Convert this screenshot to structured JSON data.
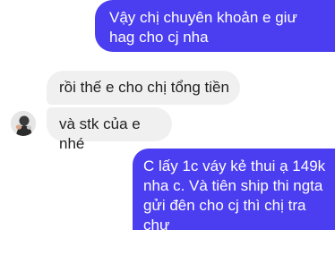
{
  "conversation": {
    "messages": [
      {
        "direction": "sent",
        "text": "Vậy chị chuyên khoản e giư\nhag cho cj nha"
      },
      {
        "direction": "received",
        "text": "rồi thế e cho chị tổng tiền"
      },
      {
        "direction": "received",
        "text": "và stk của e nhé"
      },
      {
        "direction": "sent",
        "text": "C lấy 1c váy kẻ thui ạ 149k\nnha c. Và tiên ship thi ngta\ngửi đên cho cj thì chị tra chư\nhay e trả"
      }
    ],
    "contact_avatar_icon": "user-avatar-photo"
  },
  "colors": {
    "sent_bubble": "#4b3df0",
    "sent_text": "#ffffff",
    "received_bubble": "#f0f0f0",
    "received_text": "#222222",
    "background": "#ffffff"
  }
}
